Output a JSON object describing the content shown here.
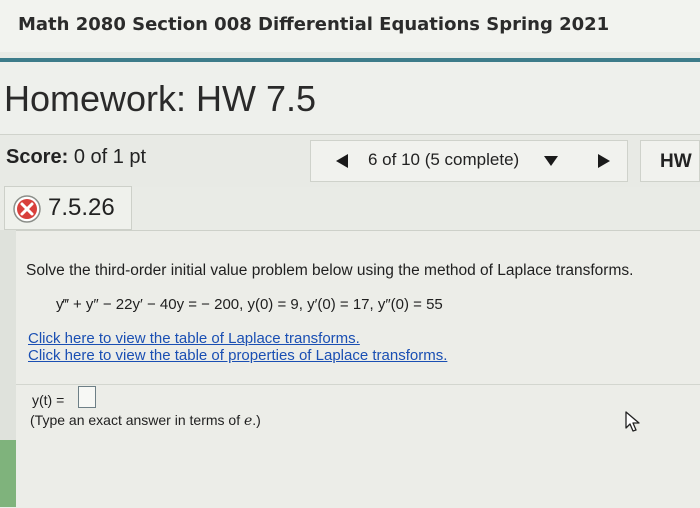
{
  "course": {
    "title": "Math 2080 Section 008 Differential Equations Spring 2021"
  },
  "homework": {
    "title": "Homework: HW 7.5",
    "score_label": "Score:",
    "score_value": "0 of 1 pt",
    "short_label": "HW"
  },
  "navigation": {
    "position_text": "6 of 10 (5 complete)"
  },
  "question": {
    "number": "7.5.26",
    "status": "incorrect",
    "instruction": "Solve the third-order initial value problem below using the method of Laplace transforms.",
    "equation": "y‴ + y″ − 22y′ − 40y = − 200, y(0) = 9, y′(0) = 17, y″(0) = 55",
    "link_table": "Click here to view the table of Laplace transforms.",
    "link_properties": "Click here to view the table of properties of Laplace transforms.",
    "answer_label": "y(t) =",
    "answer_value": "",
    "hint_prefix": "(Type an exact answer in terms of ",
    "hint_var": "e",
    "hint_suffix": ".)"
  },
  "colors": {
    "accent": "#3d7c8a",
    "link": "#1a4fb3",
    "incorrect": "#d8403c"
  },
  "icons": {
    "prev": "triangle-left-icon",
    "dropdown": "caret-down-icon",
    "next": "triangle-right-icon",
    "status": "x-circle-icon",
    "cursor": "mouse-pointer-icon"
  }
}
